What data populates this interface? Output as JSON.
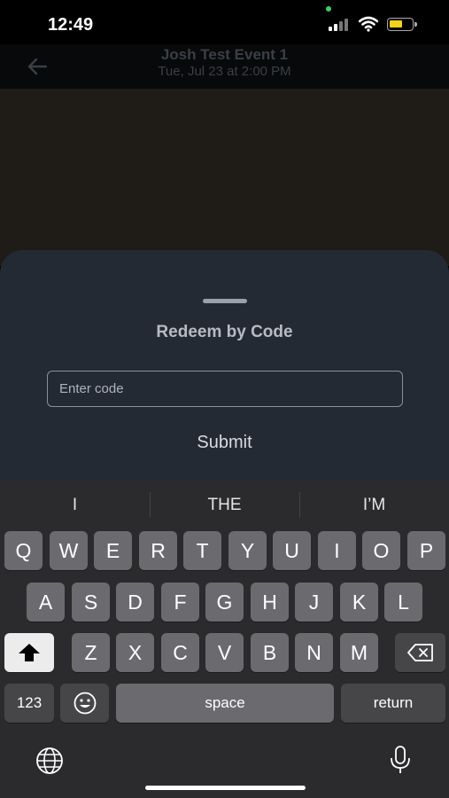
{
  "status_bar": {
    "time": "12:49"
  },
  "header": {
    "title": "Josh Test Event 1",
    "subtitle": "Tue, Jul 23 at 2:00 PM"
  },
  "sheet": {
    "title": "Redeem by Code",
    "code_input": {
      "placeholder": "Enter code",
      "value": ""
    },
    "submit_label": "Submit"
  },
  "keyboard": {
    "suggestions": [
      "I",
      "THE",
      "I’M"
    ],
    "row1": [
      "Q",
      "W",
      "E",
      "R",
      "T",
      "Y",
      "U",
      "I",
      "O",
      "P"
    ],
    "row2": [
      "A",
      "S",
      "D",
      "F",
      "G",
      "H",
      "J",
      "K",
      "L"
    ],
    "row3": [
      "Z",
      "X",
      "C",
      "V",
      "B",
      "N",
      "M"
    ],
    "numbers_label": "123",
    "space_label": "space",
    "return_label": "return"
  },
  "colors": {
    "sheet_bg": "#232a33",
    "keyboard_bg": "#2b2b2e",
    "key_bg": "#6b6b6f",
    "battery": "#f5d21b"
  }
}
